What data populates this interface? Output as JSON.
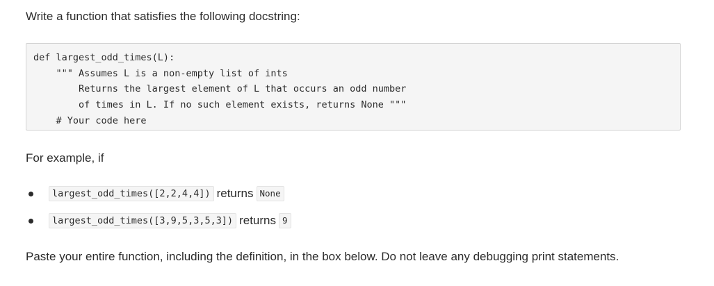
{
  "intro_text": "Write a function that satisfies the following docstring:",
  "code": {
    "lines": [
      "def largest_odd_times(L):",
      "    \"\"\" Assumes L is a non-empty list of ints",
      "        Returns the largest element of L that occurs an odd number",
      "        of times in L. If no such element exists, returns None \"\"\"",
      "    # Your code here"
    ]
  },
  "example_intro": "For example, if",
  "examples": [
    {
      "call": "largest_odd_times([2,2,4,4])",
      "returns_word": "returns",
      "result": "None"
    },
    {
      "call": "largest_odd_times([3,9,5,3,5,3])",
      "returns_word": "returns",
      "result": "9"
    }
  ],
  "outro_text": "Paste your entire function, including the definition, in the box below. Do not leave any debugging print statements."
}
